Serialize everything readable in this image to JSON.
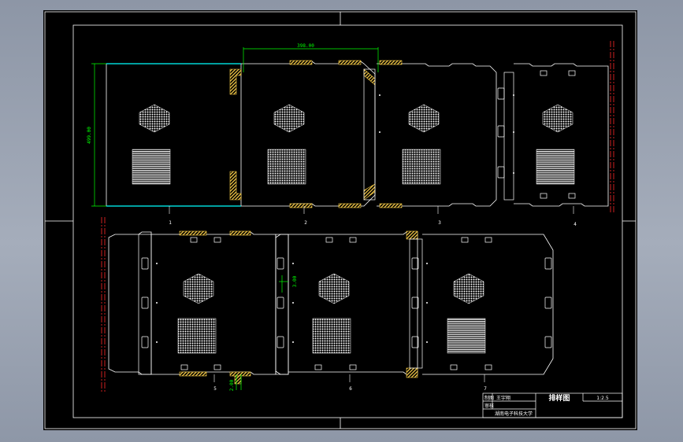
{
  "drawing": {
    "title": "排样图",
    "scale": "1:2.5",
    "table": {
      "row1_label": "制图",
      "row1_value": "王宇翔",
      "row2_label": "审核",
      "school": "湖南电子科技大学"
    },
    "part_numbers": [
      "1",
      "2",
      "3",
      "4",
      "5",
      "6",
      "7"
    ],
    "dimensions": {
      "horizontal": "398.00",
      "vertical": "499.00",
      "gap": "3.00",
      "small": "2.00"
    }
  },
  "colors": {
    "background": "#000000",
    "frame": "#ffffff",
    "dimension": "#00ff00",
    "center_line": "#ff2a2a",
    "hatch": "#ffd24a",
    "outline": "#ffffff",
    "sheet": "#00ffff"
  }
}
